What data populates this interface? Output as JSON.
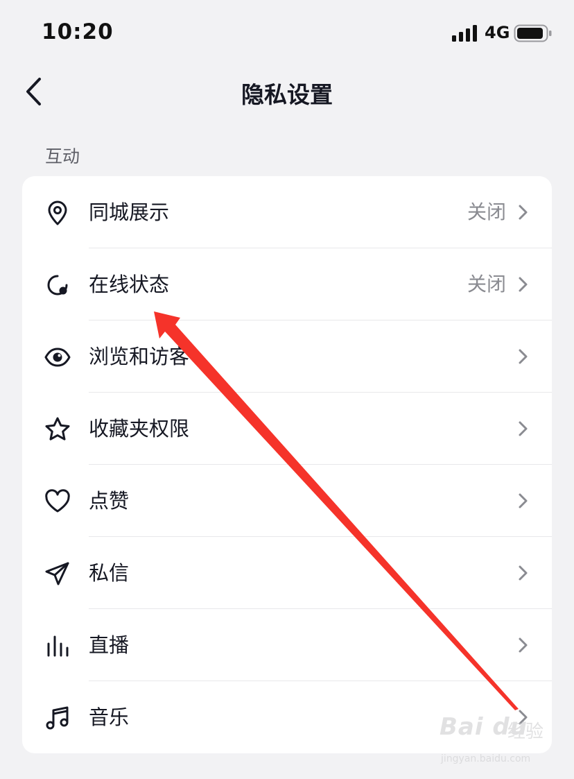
{
  "status_bar": {
    "time": "10:20",
    "network": "4G",
    "signal_icon": "cellular-signal-icon",
    "battery_icon": "battery-icon"
  },
  "nav": {
    "title": "隐私设置",
    "back_icon": "chevron-left-icon"
  },
  "section": {
    "header": "互动"
  },
  "items": [
    {
      "label": "同城展示",
      "value": "关闭",
      "icon": "location-pin-icon"
    },
    {
      "label": "在线状态",
      "value": "关闭",
      "icon": "online-status-icon"
    },
    {
      "label": "浏览和访客",
      "value": "",
      "icon": "eye-icon"
    },
    {
      "label": "收藏夹权限",
      "value": "",
      "icon": "star-icon"
    },
    {
      "label": "点赞",
      "value": "",
      "icon": "heart-icon"
    },
    {
      "label": "私信",
      "value": "",
      "icon": "paper-plane-icon"
    },
    {
      "label": "直播",
      "value": "",
      "icon": "live-bars-icon"
    },
    {
      "label": "音乐",
      "value": "",
      "icon": "music-note-icon"
    }
  ],
  "watermark": {
    "brand": "Bai du",
    "suffix": "经验",
    "url": "jingyan.baidu.com"
  },
  "colors": {
    "background": "#f2f2f4",
    "card": "#ffffff",
    "text_primary": "#161823",
    "text_secondary": "#8a8b91",
    "annotation_arrow": "#f5332a"
  }
}
